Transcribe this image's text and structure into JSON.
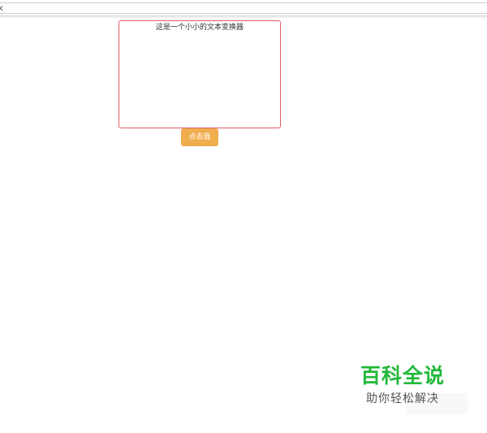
{
  "browser": {
    "address_text": "k"
  },
  "editor": {
    "text": "这是一个小小的文本变换器",
    "border_color": "#e35b66"
  },
  "action": {
    "button_label": "点击我",
    "button_color": "#f0ad4e"
  },
  "watermark": {
    "title": "百科全说",
    "subtitle": "助你轻松解决",
    "title_color": "#22b83a"
  }
}
